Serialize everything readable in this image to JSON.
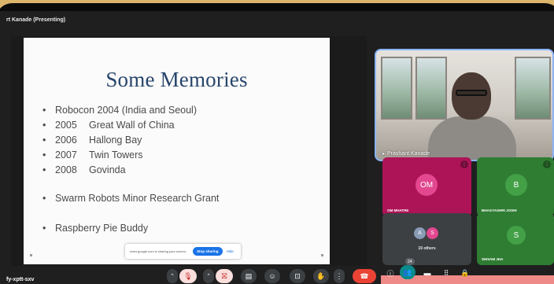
{
  "window": {
    "title": "rt Kanade (Presenting)"
  },
  "slide": {
    "title": "Some Memories",
    "bullets": [
      {
        "year": "",
        "text": "Robocon 2004 (India and Seoul)"
      },
      {
        "year": "2005",
        "text": "Great Wall of China"
      },
      {
        "year": "2006",
        "text": "Hallong Bay"
      },
      {
        "year": "2007",
        "text": "Twin Towers"
      },
      {
        "year": "2008",
        "text": "Govinda"
      },
      {
        "year": "",
        "text": "Swarm Robots Minor Research Grant"
      },
      {
        "year": "",
        "text": "Raspberry Pie Buddy"
      }
    ],
    "bullet_glyph": "•"
  },
  "share_bar": {
    "message": "meet.google.com is sharing your screen.",
    "stop_label": "Stop sharing",
    "hide_label": "Hide"
  },
  "main_participant": {
    "name": "Prashant Kanade"
  },
  "participants": [
    {
      "initials": "OM",
      "name": "OM MHATRE",
      "color": "#ad1457"
    },
    {
      "initials": "B",
      "name": "BHAGYASHRI JOSHI",
      "color": "#2e7d32"
    },
    {
      "initials": "S",
      "name": "SHIVAM JHA",
      "color": "#2e7d32"
    }
  ],
  "others": {
    "avatar_a": "A",
    "avatar_s": "S",
    "label": "19 others"
  },
  "bottom_bar": {
    "meeting_code": "fy-xptt-sxv",
    "people_count": "24"
  },
  "icons": {
    "caret": "^",
    "mic_off": "🎙",
    "cam_off": "⛝",
    "captions": "▤",
    "emoji": "☺",
    "present": "⊡",
    "raise_hand": "✋",
    "more": "⋮",
    "hangup": "☎",
    "info": "ⓘ",
    "people": "👥",
    "chat": "▬",
    "activities": "⠿",
    "host": "🔒",
    "pin": "⬤",
    "name_icon": "▸"
  },
  "colors": {
    "accent": "#8ab4f8",
    "hangup": "#ea4335",
    "slide_title": "#27456b"
  }
}
